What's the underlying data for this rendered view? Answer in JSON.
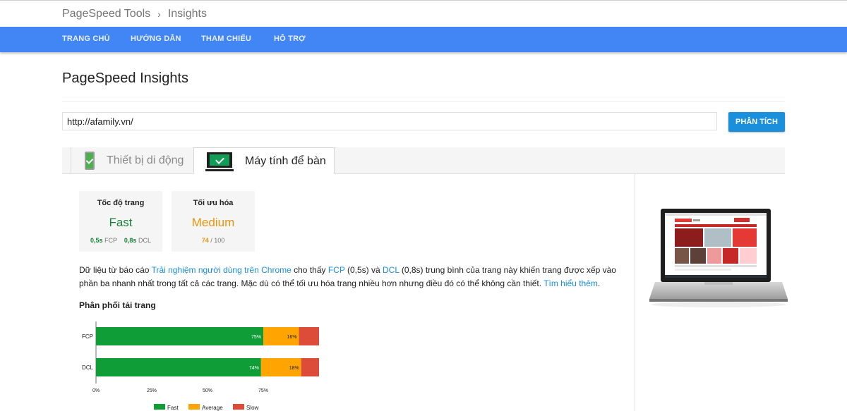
{
  "breadcrumb": {
    "parent": "PageSpeed Tools",
    "current": "Insights"
  },
  "nav": {
    "items": [
      "TRANG CHỦ",
      "HƯỚNG DẪN",
      "THAM CHIẾU",
      "HỖ TRỢ"
    ]
  },
  "page": {
    "title": "PageSpeed Insights"
  },
  "url_input": {
    "value": "http://afamily.vn/"
  },
  "analyze_button": {
    "label": "PHÂN TÍCH"
  },
  "tabs": [
    {
      "label": "Thiết bị di động",
      "icon": "mobile-phone-icon",
      "active": false
    },
    {
      "label": "Máy tính để bàn",
      "icon": "desktop-monitor-icon",
      "active": true
    }
  ],
  "cards": {
    "speed": {
      "title": "Tốc độ trang",
      "value": "Fast",
      "fcp_value": "0,5s",
      "fcp_label": "FCP",
      "dcl_value": "0,8s",
      "dcl_label": "DCL"
    },
    "optimization": {
      "title": "Tối ưu hóa",
      "value": "Medium",
      "score": "74",
      "score_sep": "/ 100"
    }
  },
  "description": {
    "p1": "Dữ liệu từ báo cáo ",
    "link_crux": "Trải nghiệm người dùng trên Chrome",
    "p2": " cho thấy ",
    "link_fcp": "FCP",
    "p3": " (0,5s) và ",
    "link_dcl": "DCL",
    "p4": " (0,8s) trung bình của trang này khiến trang được xếp vào phần ba nhanh nhất trong tất cả các trang. Mặc dù có thể tối ưu hóa trang nhiều hơn nhưng điều đó có thể không cần thiết. ",
    "link_more": "Tìm hiểu thêm",
    "p5": "."
  },
  "distribution_title": "Phân phối tải trang",
  "colors": {
    "fast": "#0f9d38",
    "average": "#ffa400",
    "slow": "#dd4b39",
    "nav": "#4285f4",
    "link": "#1a8fdc"
  },
  "chart_data": {
    "type": "bar",
    "orientation": "horizontal",
    "stacked": true,
    "categories": [
      "FCP",
      "DCL"
    ],
    "series": [
      {
        "name": "Fast",
        "values": [
          75,
          74
        ],
        "labels": [
          "75%",
          "74%"
        ]
      },
      {
        "name": "Average",
        "values": [
          16,
          18
        ],
        "labels": [
          "16%",
          "18%"
        ]
      },
      {
        "name": "Slow",
        "values": [
          9,
          8
        ],
        "labels": [
          "",
          ""
        ]
      }
    ],
    "xticks": [
      "0%",
      "25%",
      "50%",
      "75%"
    ],
    "xlim": [
      0,
      100
    ],
    "legend": "bottom",
    "grid": false
  }
}
